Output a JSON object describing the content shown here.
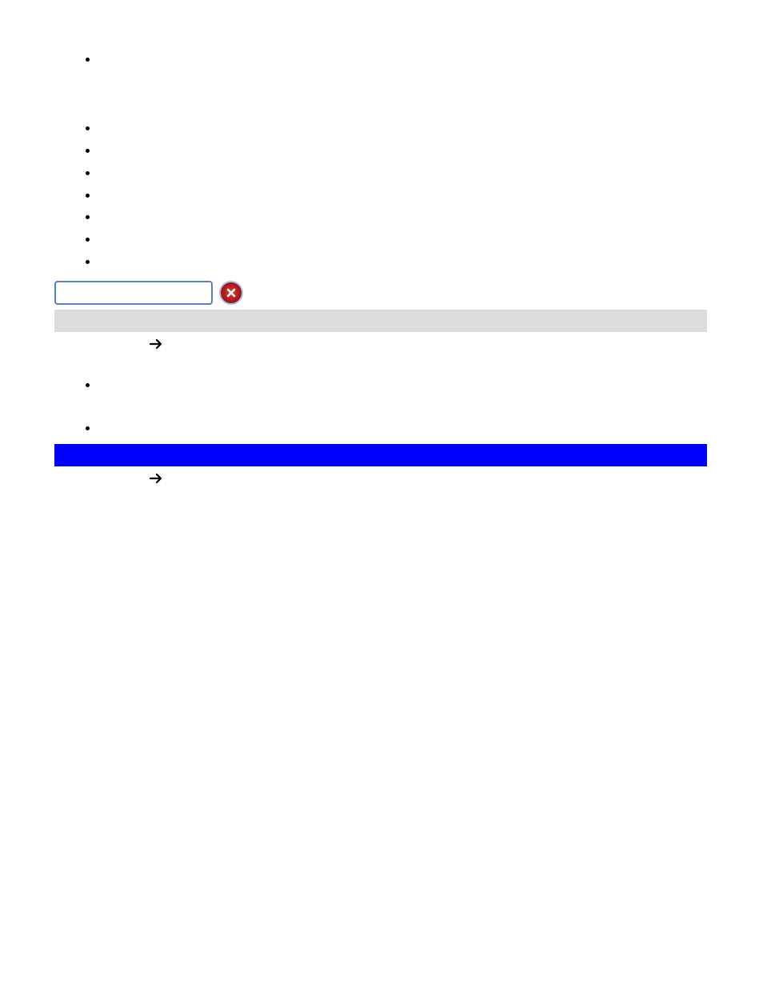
{
  "nav": {
    "items": [
      "",
      "",
      "",
      "",
      "",
      "",
      "",
      ""
    ]
  },
  "search": {
    "value": "",
    "clear_icon": "close-circle"
  },
  "mega_sections": [
    {
      "bar_color": "gray",
      "button_label": "",
      "fine_print": "",
      "items": [
        "",
        ""
      ]
    },
    {
      "bar_color": "blue",
      "button_label": "",
      "fine_print": "",
      "items": []
    }
  ]
}
